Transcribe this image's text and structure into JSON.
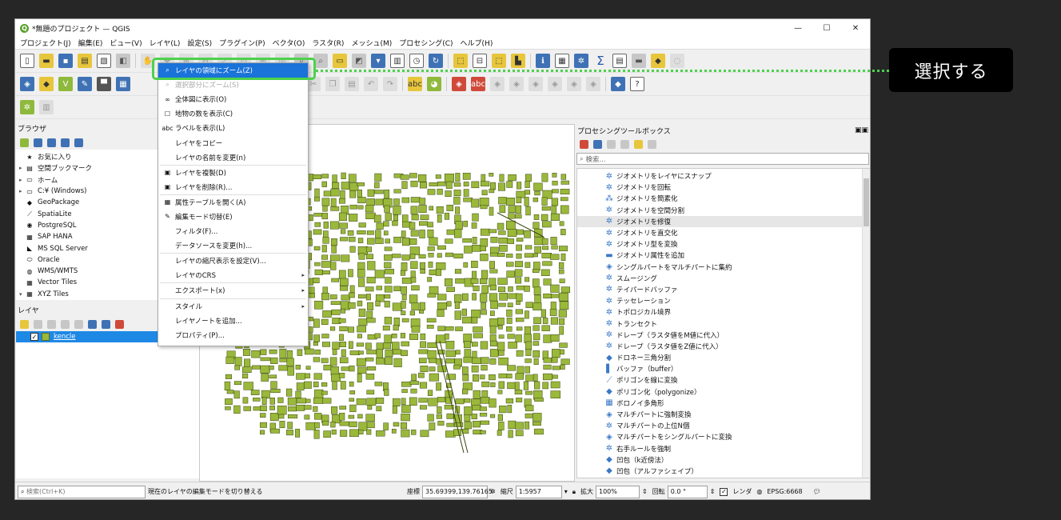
{
  "window": {
    "title": "*無題のプロジェクト — QGIS",
    "logo": "Q",
    "minimize": "—",
    "maximize": "☐",
    "close": "✕"
  },
  "menu": [
    "プロジェクト(J)",
    "編集(E)",
    "ビュー(V)",
    "レイヤ(L)",
    "設定(S)",
    "プラグイン(P)",
    "ベクタ(O)",
    "ラスタ(R)",
    "メッシュ(M)",
    "プロセシング(C)",
    "ヘルプ(H)"
  ],
  "browser": {
    "title": "ブラウザ",
    "items": [
      {
        "label": "お気に入り",
        "icon": "star-icon",
        "glyph": "★",
        "expand": ""
      },
      {
        "label": "空間ブックマーク",
        "icon": "bookmark-icon",
        "glyph": "▤",
        "expand": "▸"
      },
      {
        "label": "ホーム",
        "icon": "home-folder-icon",
        "glyph": "▭",
        "expand": "▸"
      },
      {
        "label": "C:¥ (Windows)",
        "icon": "drive-icon",
        "glyph": "▭",
        "expand": "▸"
      },
      {
        "label": "GeoPackage",
        "icon": "geopackage-icon",
        "glyph": "◆",
        "expand": ""
      },
      {
        "label": "SpatiaLite",
        "icon": "spatialite-icon",
        "glyph": "⟋",
        "expand": ""
      },
      {
        "label": "PostgreSQL",
        "icon": "postgresql-icon",
        "glyph": "◉",
        "expand": ""
      },
      {
        "label": "SAP HANA",
        "icon": "sap-hana-icon",
        "glyph": "▦",
        "expand": ""
      },
      {
        "label": "MS SQL Server",
        "icon": "mssql-icon",
        "glyph": "◣",
        "expand": ""
      },
      {
        "label": "Oracle",
        "icon": "oracle-icon",
        "glyph": "⬭",
        "expand": ""
      },
      {
        "label": "WMS/WMTS",
        "icon": "wms-icon",
        "glyph": "◍",
        "expand": ""
      },
      {
        "label": "Vector Tiles",
        "icon": "vector-tiles-icon",
        "glyph": "▦",
        "expand": ""
      },
      {
        "label": "XYZ Tiles",
        "icon": "xyz-tiles-icon",
        "glyph": "▦",
        "expand": "▾"
      }
    ]
  },
  "layers": {
    "title": "レイヤ",
    "items": [
      {
        "name": "kencle",
        "checked": "✓"
      }
    ]
  },
  "context_menu": [
    {
      "label": "レイヤの領域にズーム(Z)",
      "icon": "zoom-layer-icon",
      "glyph": "⌕",
      "state": "highlight"
    },
    {
      "label": "選択部分にズーム(S)",
      "icon": "zoom-selection-icon",
      "glyph": "⌕",
      "state": "disabled"
    },
    {
      "label": "全体図に表示(O)",
      "icon": "overview-icon",
      "glyph": "∞",
      "state": ""
    },
    {
      "label": "地物の数を表示(C)",
      "icon": "checkbox-icon",
      "glyph": "☐",
      "state": ""
    },
    {
      "label": "ラベルを表示(L)",
      "icon": "label-icon",
      "glyph": "abc",
      "state": ""
    },
    {
      "label": "レイヤをコピー",
      "icon": "",
      "glyph": "",
      "state": "",
      "noicon": true
    },
    {
      "label": "レイヤの名前を変更(n)",
      "icon": "",
      "glyph": "",
      "state": "",
      "noicon": true,
      "sepAfter": true
    },
    {
      "label": "レイヤを複製(D)",
      "icon": "duplicate-layer-icon",
      "glyph": "▣",
      "state": ""
    },
    {
      "label": "レイヤを削除(R)...",
      "icon": "remove-layer-icon",
      "glyph": "▣",
      "state": "",
      "sepAfter": true
    },
    {
      "label": "属性テーブルを開く(A)",
      "icon": "attribute-table-icon",
      "glyph": "▦",
      "state": ""
    },
    {
      "label": "編集モード切替(E)",
      "icon": "pencil-icon",
      "glyph": "✎",
      "state": ""
    },
    {
      "label": "フィルタ(F)...",
      "icon": "",
      "glyph": "",
      "state": "",
      "noicon": true
    },
    {
      "label": "データソースを変更(h)...",
      "icon": "",
      "glyph": "",
      "state": "",
      "noicon": true,
      "sepAfter": true
    },
    {
      "label": "レイヤの縮尺表示を設定(V)...",
      "icon": "",
      "glyph": "",
      "state": "",
      "noicon": true
    },
    {
      "label": "レイヤのCRS",
      "icon": "",
      "glyph": "",
      "state": "",
      "noicon": true,
      "submenu": "▸",
      "sepAfter": true
    },
    {
      "label": "エクスポート(x)",
      "icon": "",
      "glyph": "",
      "state": "",
      "noicon": true,
      "submenu": "▸",
      "sepAfter": true
    },
    {
      "label": "スタイル",
      "icon": "",
      "glyph": "",
      "state": "",
      "noicon": true,
      "submenu": "▸"
    },
    {
      "label": "レイヤノートを追加...",
      "icon": "",
      "glyph": "",
      "state": "",
      "noicon": true
    },
    {
      "label": "プロパティ(P)...",
      "icon": "",
      "glyph": "",
      "state": "",
      "noicon": true
    }
  ],
  "processing": {
    "title": "プロセシングツールボックス",
    "search_placeholder": "検索...",
    "items": [
      "ジオメトリをレイヤにスナップ",
      "ジオメトリを回転",
      "ジオメトリを簡素化",
      "ジオメトリを空間分割",
      "ジオメトリを修復",
      "ジオメトリを直交化",
      "ジオメトリ型を変換",
      "ジオメトリ属性を追加",
      "シングルパートをマルチパートに集約",
      "スムージング",
      "テイパードバッファ",
      "テッセレーション",
      "トポロジカル境界",
      "トランセクト",
      "ドレープ（ラスタ値をM値に代入）",
      "ドレープ（ラスタ値をZ値に代入）",
      "ドロネー三角分割",
      "バッファ（buffer）",
      "ポリゴンを線に変換",
      "ポリゴン化（polygonize）",
      "ボロノイ多角形",
      "マルチパートに強制変換",
      "マルチパートの上位N個",
      "マルチパートをシングルパートに変換",
      "右手ルールを強制",
      "凹包（k近傍法）",
      "凹包（アルファシェイプ）"
    ],
    "selected_index": 4
  },
  "status": {
    "search_placeholder": "検索(Ctrl+K)",
    "message": "現在のレイヤの編集モードを切り替える",
    "coord_label": "座標",
    "coord": "35.69399,139.76165",
    "scale_label": "縮尺",
    "scale": "1:5957",
    "magnifier_label": "拡大",
    "magnifier": "100%",
    "rotation_label": "回転",
    "rotation": "0.0 °",
    "render_label": "レンダ",
    "crs": "EPSG:6668"
  },
  "callout": "選択する",
  "colors": {
    "accent_green": "#4cd24c",
    "highlight_blue": "#1a73d9",
    "polygon_fill": "#9ab83a"
  }
}
